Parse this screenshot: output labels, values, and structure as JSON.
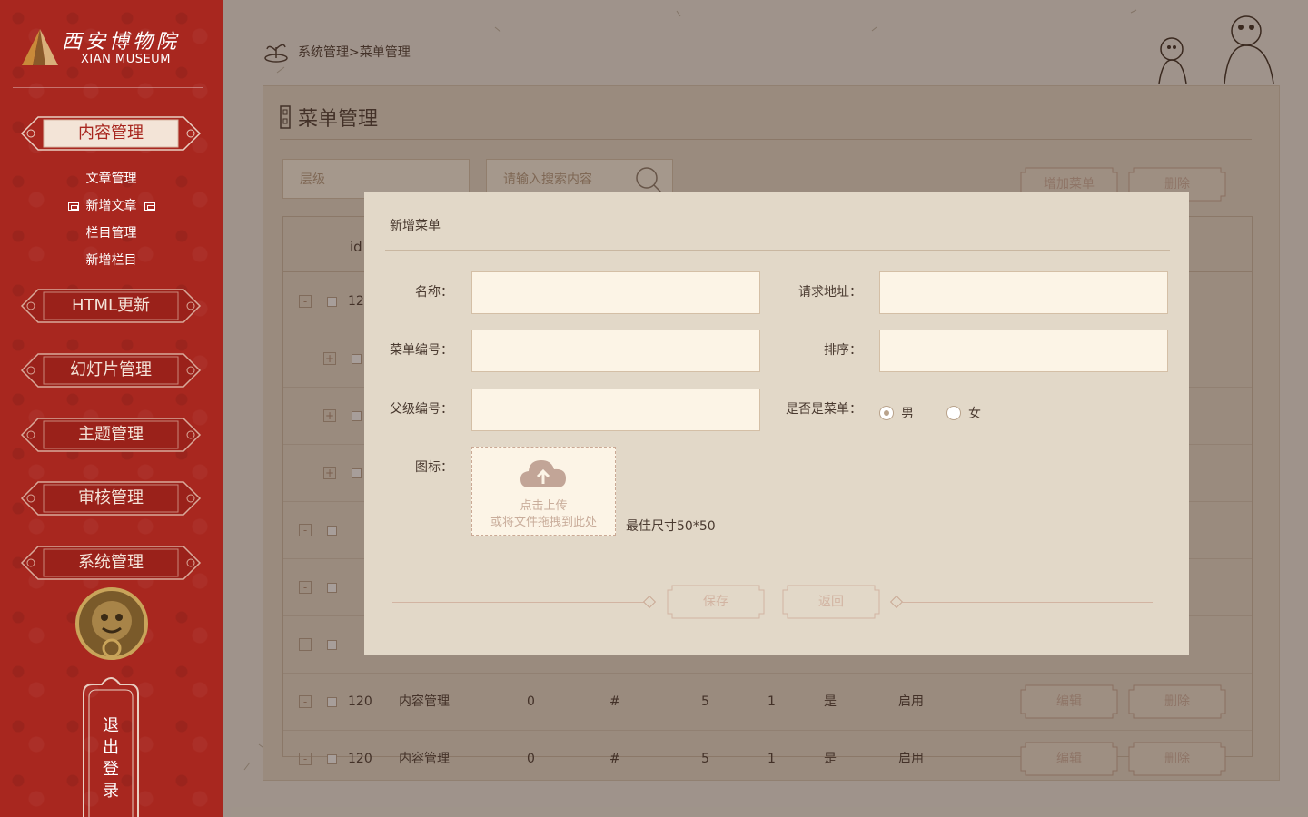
{
  "brand": {
    "name_cn": "西安博物院",
    "name_en": "XIAN MUSEUM"
  },
  "sidebar": {
    "sections": [
      {
        "label": "内容管理",
        "active": true
      },
      {
        "label": "HTML更新",
        "active": false
      },
      {
        "label": "幻灯片管理",
        "active": false
      },
      {
        "label": "主题管理",
        "active": false
      },
      {
        "label": "审核管理",
        "active": false
      },
      {
        "label": "系统管理",
        "active": false
      }
    ],
    "sub_items": [
      "文章管理",
      "新增文章",
      "栏目管理",
      "新增栏目"
    ],
    "logout": [
      "退",
      "出",
      "登",
      "录"
    ]
  },
  "breadcrumb": "系统管理>菜单管理",
  "page": {
    "title": "菜单管理",
    "level_placeholder": "层级",
    "search_placeholder": "请输入搜索内容",
    "add_button": "增加菜单",
    "delete_button": "删除"
  },
  "table": {
    "header": {
      "id": "id"
    },
    "rows": [
      {
        "id": "120",
        "name": "内容管理",
        "parent": "0",
        "url": "#",
        "sort": "5",
        "level": "1",
        "is_menu": "是",
        "status": "启用",
        "edit": "编辑",
        "delete": "删除"
      },
      {
        "id": "120",
        "name": "内容管理",
        "parent": "0",
        "url": "#",
        "sort": "5",
        "level": "1",
        "is_menu": "是",
        "status": "启用",
        "edit": "编辑",
        "delete": "删除"
      }
    ]
  },
  "dialog": {
    "title": "新增菜单",
    "fields": {
      "name": "名称：",
      "request_url": "请求地址：",
      "menu_code": "菜单编号：",
      "sort": "排序：",
      "parent_code": "父级编号：",
      "is_menu": "是否是菜单：",
      "icon": "图标："
    },
    "radio": {
      "option_1": "男",
      "option_2": "女",
      "selected": "男"
    },
    "upload": {
      "line1": "点击上传",
      "line2": "或将文件拖拽到此处"
    },
    "size_hint": "最佳尺寸50*50",
    "save_button": "保存",
    "back_button": "返回"
  },
  "colors": {
    "sidebar": "#a8271f",
    "panel": "#e7dccd",
    "dialog": "#e2d8c8",
    "accent_muted": "#d2b4a2"
  }
}
